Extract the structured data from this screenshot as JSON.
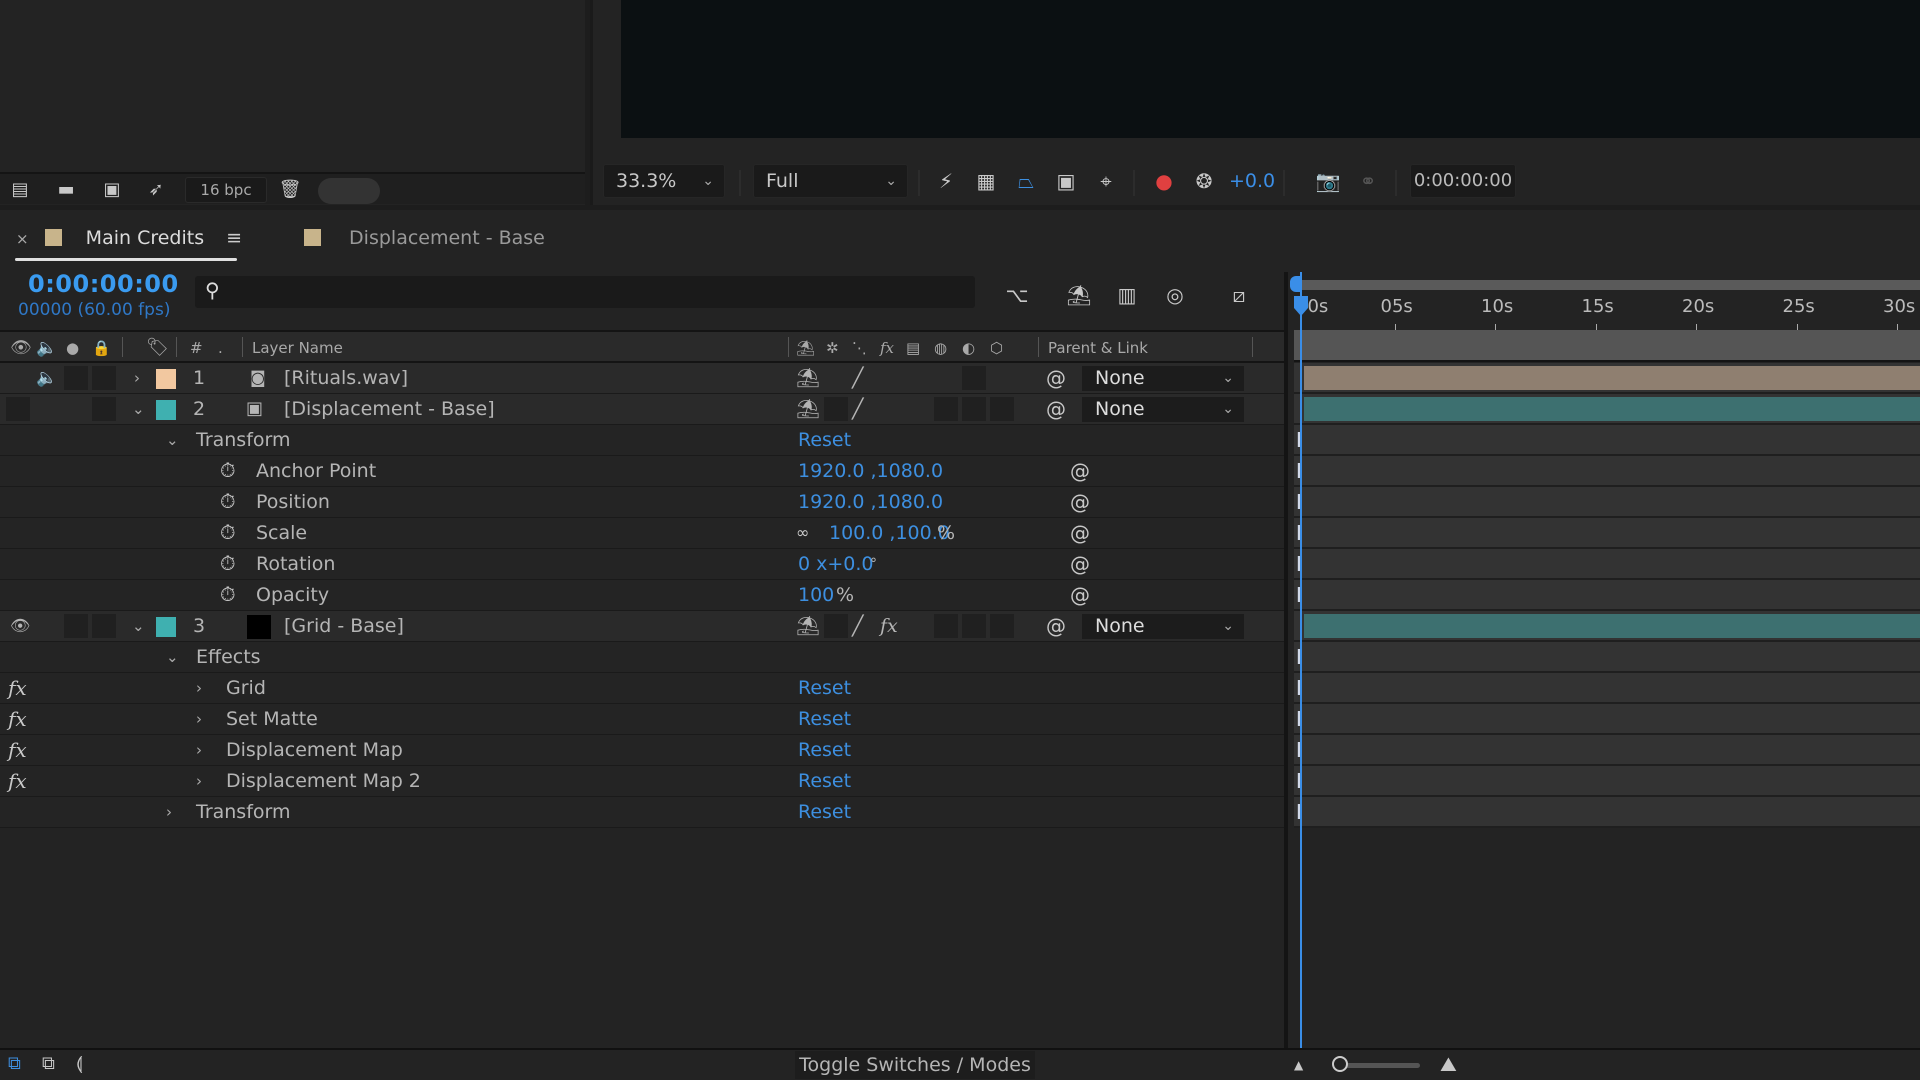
{
  "project_panel": {
    "bit_depth": "16 bpc",
    "icons": [
      "interpret-footage-icon",
      "new-folder-icon",
      "new-composition-icon",
      "render-queue-icon",
      "trash-icon"
    ]
  },
  "viewer": {
    "zoom": "33.3%",
    "resolution": "Full",
    "exposure": "+0.0",
    "timecode": "0:00:00:00"
  },
  "tabs": [
    {
      "label": "Main Credits",
      "active": true,
      "color": "#c8b48b"
    },
    {
      "label": "Displacement - Base",
      "active": false,
      "color": "#c8b48b"
    }
  ],
  "timeline": {
    "current_time": "0:00:00:00",
    "frame_info": "00000 (60.00 fps)",
    "search_placeholder": "",
    "ruler": [
      "00s",
      "05s",
      "10s",
      "15s",
      "20s",
      "25s",
      "30s"
    ],
    "columns": {
      "number": "#",
      "layer_name": "Layer Name",
      "parent_link": "Parent & Link"
    }
  },
  "layers": [
    {
      "index": "1",
      "name": "[Rituals.wav]",
      "color": "#f2c8a0",
      "parent": "None",
      "bar_color": "#8f7f70",
      "expanded": false
    },
    {
      "index": "2",
      "name": "[Displacement - Base]",
      "color": "#3fb0b0",
      "parent": "None",
      "bar_color": "#3d7070",
      "expanded": true
    },
    {
      "index": "3",
      "name": "[Grid - Base]",
      "color": "#3fb0b0",
      "parent": "None",
      "bar_color": "#3d7070",
      "expanded": true
    }
  ],
  "layer2_transform": {
    "group": "Transform",
    "reset": "Reset",
    "properties": [
      {
        "name": "Anchor Point",
        "value": "1920.0 ,1080.0",
        "unit": ""
      },
      {
        "name": "Position",
        "value": "1920.0 ,1080.0",
        "unit": ""
      },
      {
        "name": "Scale",
        "value": "100.0 ,100.0",
        "unit": "%"
      },
      {
        "name": "Rotation",
        "value": "0 x+0.0",
        "unit": "°"
      },
      {
        "name": "Opacity",
        "value": "100",
        "unit": "%"
      }
    ]
  },
  "layer3_effects": {
    "group": "Effects",
    "effects": [
      {
        "name": "Grid",
        "reset": "Reset"
      },
      {
        "name": "Set Matte",
        "reset": "Reset"
      },
      {
        "name": "Displacement Map",
        "reset": "Reset"
      },
      {
        "name": "Displacement Map 2",
        "reset": "Reset"
      }
    ],
    "transform": {
      "name": "Transform",
      "reset": "Reset"
    }
  },
  "bottom_bar": {
    "toggle_label": "Toggle Switches / Modes"
  }
}
